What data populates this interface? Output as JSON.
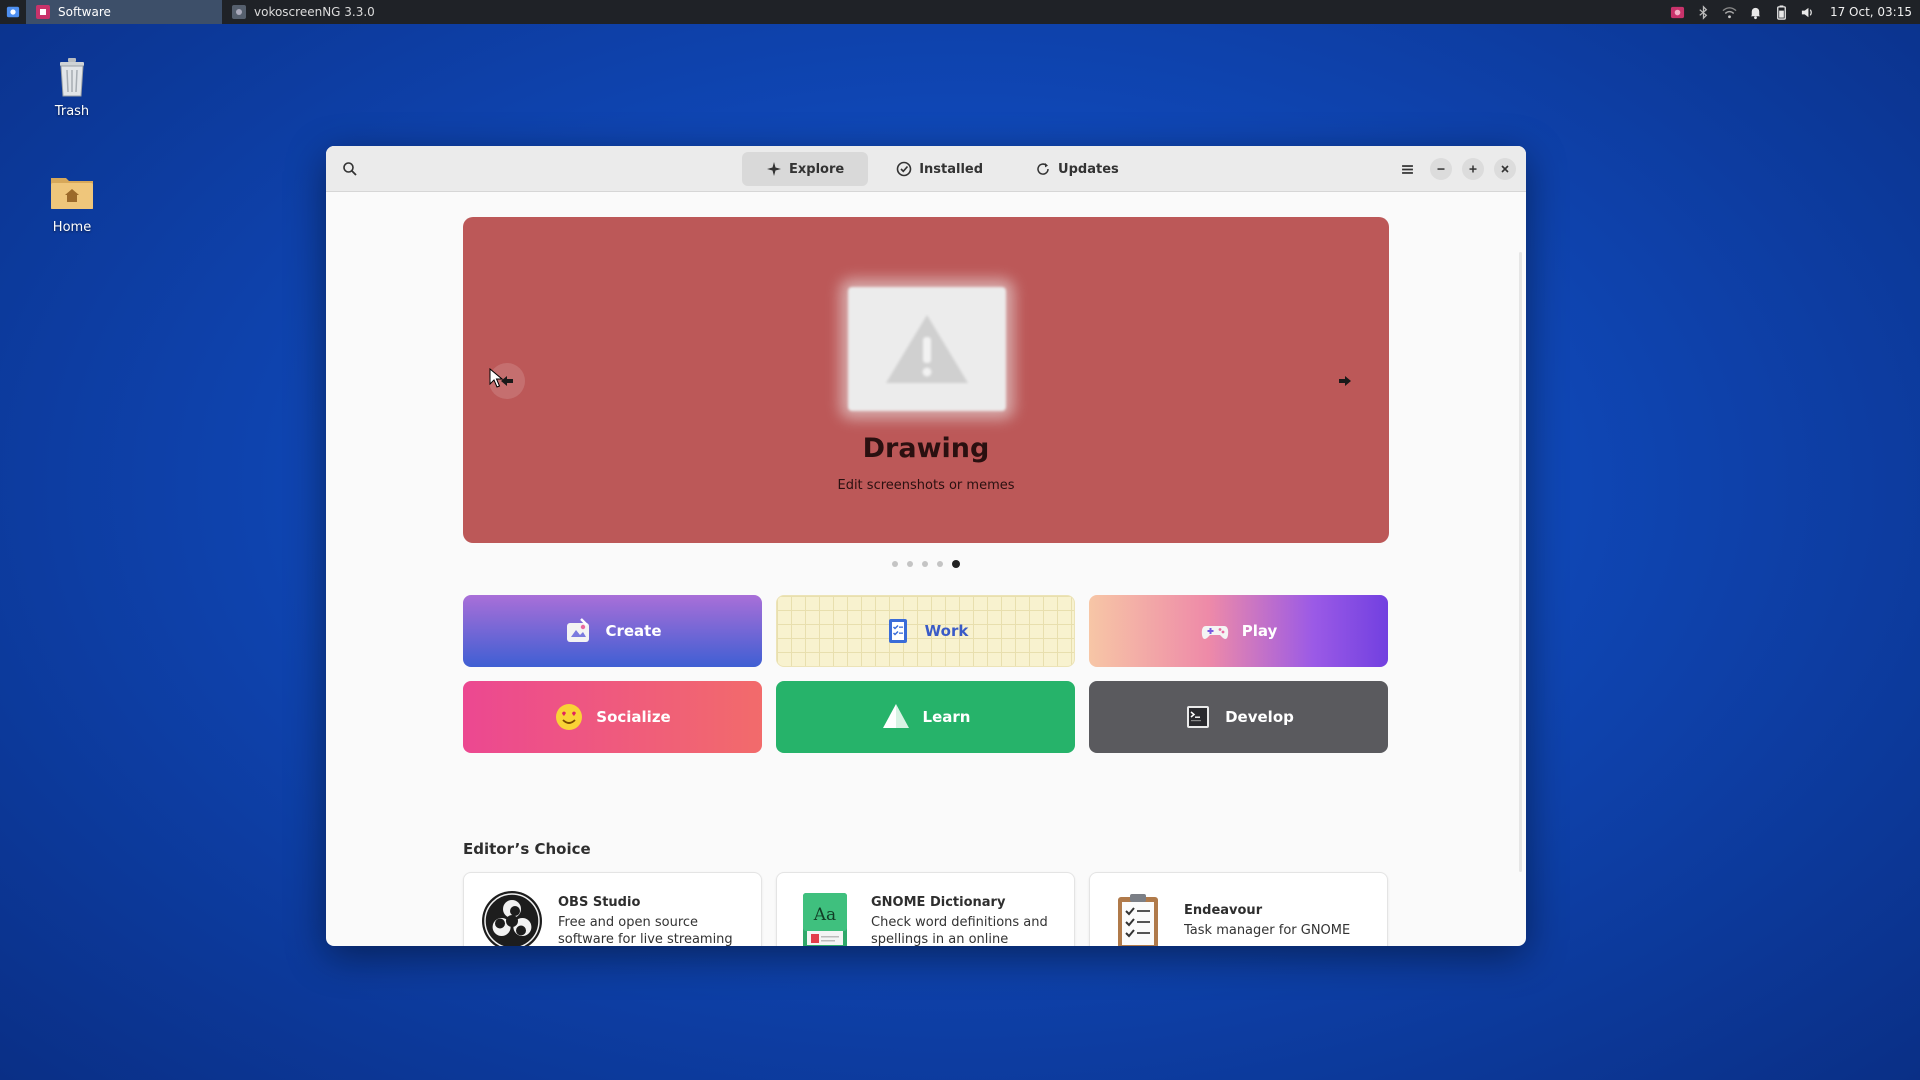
{
  "panel": {
    "tasks": [
      {
        "label": "Software",
        "active": true
      },
      {
        "label": "vokoscreenNG 3.3.0",
        "active": false
      }
    ],
    "clock": "17 Oct, 03:15"
  },
  "desktop": {
    "icons": [
      {
        "label": "Trash"
      },
      {
        "label": "Home"
      }
    ]
  },
  "window": {
    "tabs": [
      {
        "label": "Explore",
        "icon": "sparkle-icon",
        "active": true
      },
      {
        "label": "Installed",
        "icon": "check-circle-icon",
        "active": false
      },
      {
        "label": "Updates",
        "icon": "refresh-icon",
        "active": false
      }
    ]
  },
  "banner": {
    "title": "Drawing",
    "subtitle": "Edit screenshots or memes",
    "background": "#bc5858",
    "slide_count": 5,
    "active_slide": 5
  },
  "categories": [
    {
      "label": "Create",
      "icon": "create-icon"
    },
    {
      "label": "Work",
      "icon": "work-icon"
    },
    {
      "label": "Play",
      "icon": "gamepad-icon"
    },
    {
      "label": "Socialize",
      "icon": "emoji-icon"
    },
    {
      "label": "Learn",
      "icon": "sail-icon"
    },
    {
      "label": "Develop",
      "icon": "terminal-icon"
    }
  ],
  "editors_choice": {
    "title": "Editor’s Choice",
    "apps": [
      {
        "name": "OBS Studio",
        "description": "Free and open source software for live streaming and screen ..."
      },
      {
        "name": "GNOME Dictionary",
        "description": "Check word definitions and spellings in an online dictionary"
      },
      {
        "name": "Endeavour",
        "description": "Task manager for GNOME"
      }
    ]
  },
  "colors": {
    "desktop_bg": "#0f46b4",
    "panel_bg": "#1f2227",
    "accent": "#3a5bc7"
  }
}
